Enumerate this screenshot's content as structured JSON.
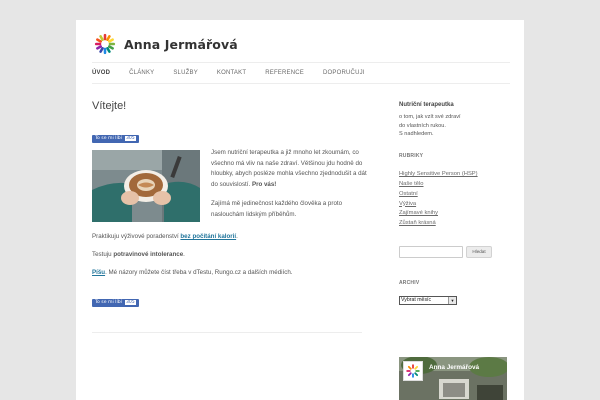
{
  "site": {
    "title": "Anna Jermářová"
  },
  "nav": {
    "items": [
      "ÚVOD",
      "ČLÁNKY",
      "SLUŽBY",
      "KONTAKT",
      "REFERENCE",
      "DOPORUČUJI"
    ]
  },
  "post": {
    "title": "Vítejte!",
    "like_label": "To se mi líbí",
    "like_count": "305",
    "intro1_pre": "Jsem nutriční terapeutka a již mnoho let zkoumám, co všechno má vliv na naše zdraví. Většinou jdu hodně do hloubky, abych posléze mohla všechno zjednodušit a dát do souvislostí.",
    "intro1_bold": "Pro vás!",
    "intro2": "Zajímá mě jedinečnost každého člověka a proto naslouchám lidským příběhům.",
    "p3_pre": "Praktikuju výživové poradenství",
    "p3_link": "bez počítání kalorií",
    "p3_post": ".",
    "p4_pre": "Testuju",
    "p4_bold": "potravinové intolerance",
    "p4_post": ".",
    "p5_link": "Píšu",
    "p5_post": ". Mé názory můžete číst třeba v dTestu, Rungo.cz a dalších médiích."
  },
  "sidebar": {
    "about_title": "Nutriční terapeutka",
    "about_lines": [
      "o tom, jak vzít své zdraví",
      "do vlastních rukou.",
      "S nadhledem."
    ],
    "categories_title": "RUBRIKY",
    "categories": [
      "Highly Sensitive Person (HSP)",
      "Naše tělo",
      "Ostatní",
      "Výživa",
      "Zajímavé knihy",
      "Zůstaň krásná"
    ],
    "search_button": "Hledat",
    "archive_title": "ARCHIV",
    "archive_select": "Vybrat měsíc",
    "fb_name": "Anna Jermářová"
  },
  "colors": {
    "link": "#21759b",
    "fb_blue": "#4267b2",
    "background": "#e6e6e6"
  },
  "icons": {
    "logo": "flower-logo-icon",
    "archive_arrow": "chevron-down-icon"
  }
}
